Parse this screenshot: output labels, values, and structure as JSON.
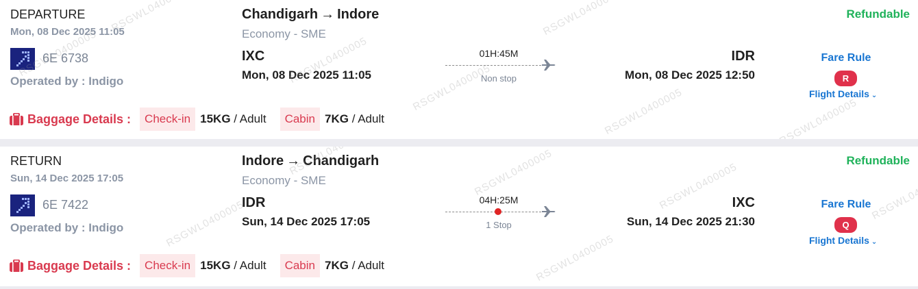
{
  "legs": [
    {
      "type": "DEPARTURE",
      "date": "Mon, 08 Dec 2025 11:05",
      "airline_logo_icon": "indigo-logo-icon",
      "flight_no": "6E 6738",
      "operated_by": "Operated by : Indigo",
      "route_from": "Chandigarh",
      "route_arrow": "→",
      "route_to": "Indore",
      "cabin_class": "Economy - SME",
      "origin_code": "IXC",
      "origin_time": "Mon, 08 Dec 2025 11:05",
      "duration": "01H:45M",
      "stops": "Non stop",
      "has_stop_dot": false,
      "dest_code": "IDR",
      "dest_time": "Mon, 08 Dec 2025 12:50",
      "refundable": "Refundable",
      "fare_rule": "Fare Rule",
      "fare_class": "R",
      "flight_details": "Flight Details",
      "baggage_label": "Baggage Details :",
      "checkin_label": "Check-in",
      "checkin_weight": "15KG",
      "checkin_unit": "/ Adult",
      "cabin_label": "Cabin",
      "cabin_weight": "7KG",
      "cabin_unit": "/ Adult"
    },
    {
      "type": "RETURN",
      "date": "Sun, 14 Dec 2025 17:05",
      "airline_logo_icon": "indigo-logo-icon",
      "flight_no": "6E 7422",
      "operated_by": "Operated by : Indigo",
      "route_from": "Indore",
      "route_arrow": "→",
      "route_to": "Chandigarh",
      "cabin_class": "Economy - SME",
      "origin_code": "IDR",
      "origin_time": "Sun, 14 Dec 2025 17:05",
      "duration": "04H:25M",
      "stops": "1 Stop",
      "has_stop_dot": true,
      "dest_code": "IXC",
      "dest_time": "Sun, 14 Dec 2025 21:30",
      "refundable": "Refundable",
      "fare_rule": "Fare Rule",
      "fare_class": "Q",
      "flight_details": "Flight Details",
      "baggage_label": "Baggage Details :",
      "checkin_label": "Check-in",
      "checkin_weight": "15KG",
      "checkin_unit": "/ Adult",
      "cabin_label": "Cabin",
      "cabin_weight": "7KG",
      "cabin_unit": "/ Adult"
    }
  ],
  "watermark": "RSGWL0400005",
  "colors": {
    "refundable": "#1fb25a",
    "link": "#1976d2",
    "baggage": "#d93a4f",
    "fare_badge": "#e0314b",
    "airline_logo": "#1a237e"
  }
}
